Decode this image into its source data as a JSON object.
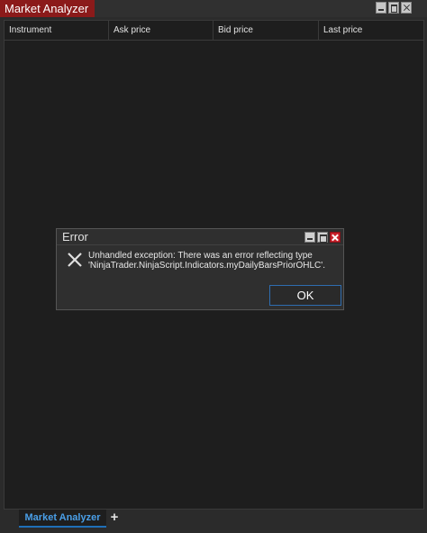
{
  "window": {
    "title": "Market Analyzer"
  },
  "grid": {
    "columns": [
      "Instrument",
      "Ask price",
      "Bid price",
      "Last price"
    ],
    "rows": []
  },
  "tabs": {
    "items": [
      {
        "label": "Market Analyzer",
        "active": true
      }
    ],
    "add_label": "+"
  },
  "dialog": {
    "title": "Error",
    "message_line1": "Unhandled exception: There was an error reflecting type",
    "message_line2": "'NinjaTrader.NinjaScript.Indicators.myDailyBarsPriorOHLC'.",
    "ok_label": "OK",
    "icon": "close-x-icon"
  },
  "colors": {
    "title_accent": "#8b1a1a",
    "tab_accent": "#4a9fe8",
    "close_button": "#c8202a",
    "ok_border": "#2e6db0"
  }
}
